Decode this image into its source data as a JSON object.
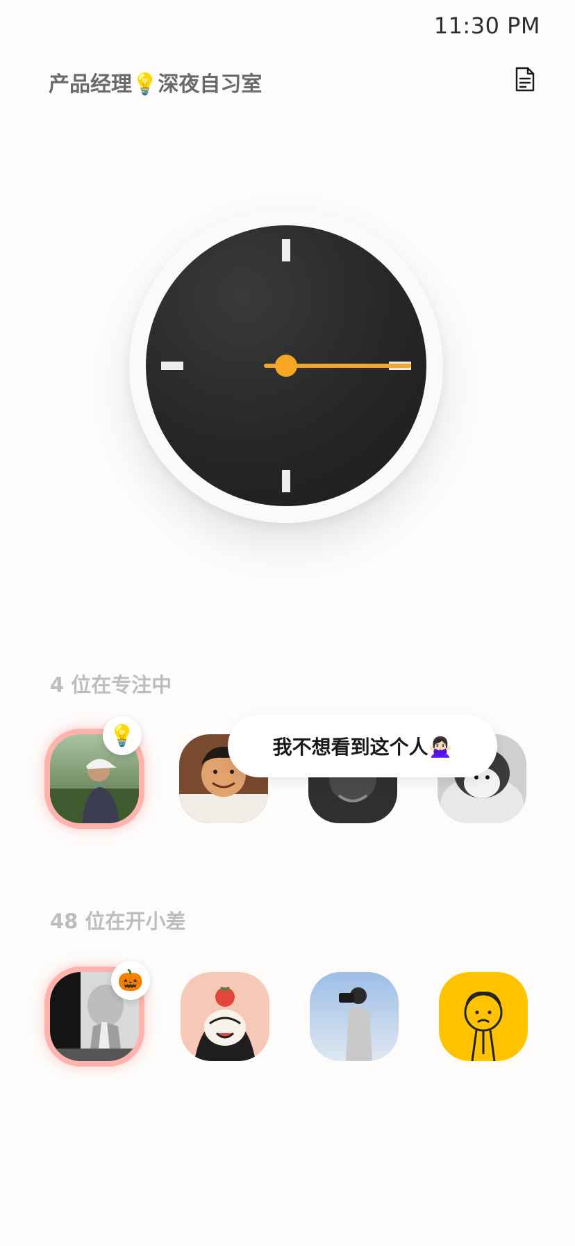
{
  "status_bar": {
    "time": "11:30 PM"
  },
  "header": {
    "room_title": "产品经理💡深夜自习室",
    "doc_icon": "document-icon"
  },
  "focus_section": {
    "label": "4 位在专注中",
    "members": [
      {
        "avatar": "person-outdoors-cap-avatar",
        "active": true,
        "badge": "💡"
      },
      {
        "avatar": "smiling-man-portrait-avatar",
        "active": false
      },
      {
        "avatar": "bw-portrait-avatar",
        "active": false
      },
      {
        "avatar": "penguin-avatar",
        "active": false
      }
    ]
  },
  "popover": {
    "text": "我不想看到这个人🙅🏻‍♀️"
  },
  "slacking_section": {
    "label": "48 位在开小差",
    "members": [
      {
        "avatar": "praying-figure-avatar",
        "active": true,
        "badge": "🎃"
      },
      {
        "avatar": "cartoon-tomato-head-avatar",
        "active": false
      },
      {
        "avatar": "photographer-avatar",
        "active": false
      },
      {
        "avatar": "sad-doodle-avatar",
        "active": false
      }
    ]
  },
  "colors": {
    "accent": "#f5a623",
    "background": "#fdfcfb",
    "clock_face": "#262626",
    "active_ring": "#ffb3ad"
  }
}
